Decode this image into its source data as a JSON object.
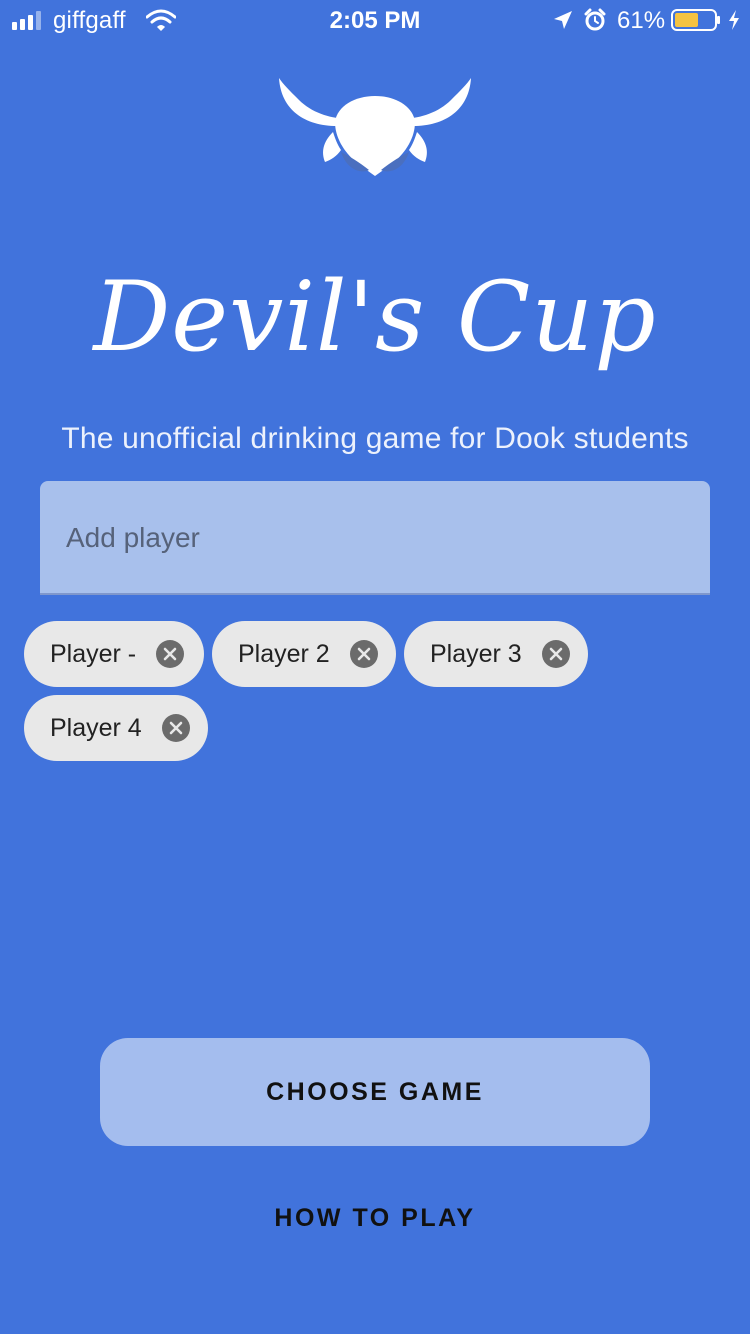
{
  "status_bar": {
    "carrier": "giffgaff",
    "time": "2:05 PM",
    "battery_percent": "61%",
    "signal_level": 3,
    "battery_level": 0.61,
    "battery_color": "#f5c342",
    "icons": [
      "signal-icon",
      "wifi-icon",
      "location-icon",
      "alarm-icon",
      "battery-icon",
      "charging-icon"
    ]
  },
  "header": {
    "logo_icon": "devil-horns-logo",
    "title": "Devil's Cup",
    "tagline": "The unofficial drinking game for Dook students"
  },
  "add_player": {
    "placeholder": "Add player",
    "value": ""
  },
  "players": [
    {
      "name": "Player -"
    },
    {
      "name": "Player 2"
    },
    {
      "name": "Player 3"
    },
    {
      "name": "Player 4"
    }
  ],
  "actions": {
    "choose_game_label": "CHOOSE GAME",
    "how_to_play_label": "HOW TO PLAY"
  },
  "colors": {
    "background": "#4173dc",
    "input_background": "#a8c0ec",
    "chip_background": "#e8e8e8",
    "button_background": "#a4bdee"
  }
}
